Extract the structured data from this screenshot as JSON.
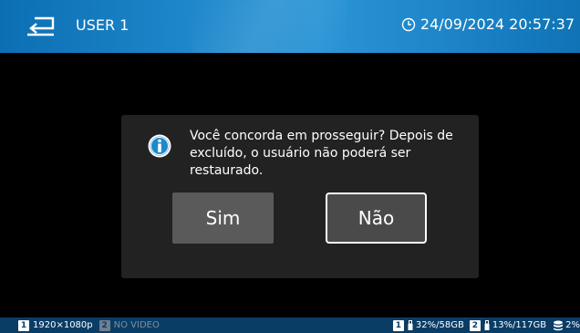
{
  "header": {
    "title": "USER 1",
    "datetime": "24/09/2024 20:57:37",
    "back_icon": "back-arrow-icon",
    "clock_icon": "clock-icon"
  },
  "dialog": {
    "icon": "info-icon",
    "message": "Você concorda em prosseguir? Depois de excluído, o usuário não poderá ser restaurado.",
    "yes_label": "Sim",
    "no_label": "Não"
  },
  "statusbar": {
    "input1_num": "1",
    "input1_res": "1920×1080p",
    "input2_num": "2",
    "input2_text": "NO VIDEO",
    "usb1_num": "1",
    "usb1_usage": "32%/58GB",
    "usb2_num": "2",
    "usb2_usage": "13%/117GB",
    "storage_pct": "2%"
  },
  "colors": {
    "header_blue": "#1f88cc",
    "statusbar_blue": "#0a3d66",
    "dialog_bg": "#222222",
    "button_gray": "#5a5a5a"
  }
}
